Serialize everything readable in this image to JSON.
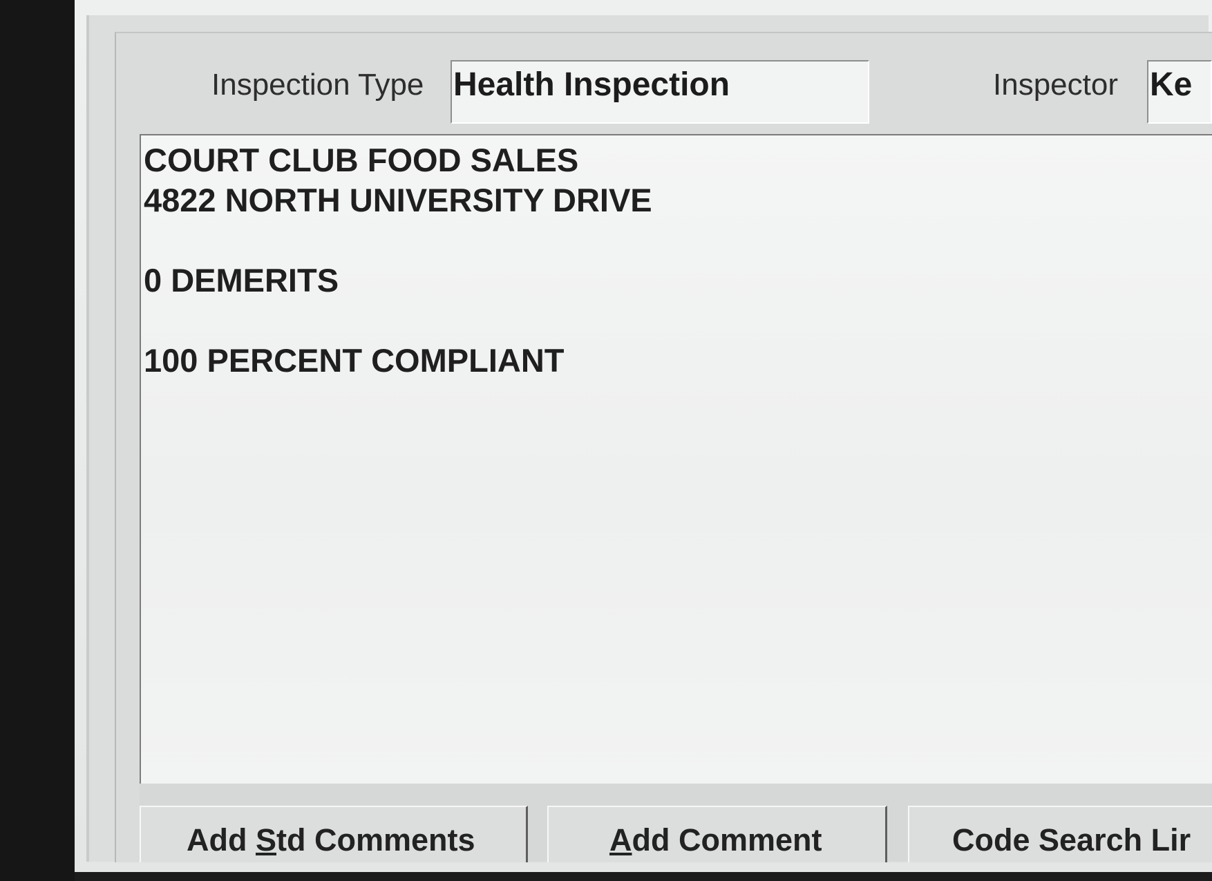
{
  "form": {
    "inspection_type_label": "Inspection Type",
    "inspection_type_value": "Health Inspection",
    "inspector_label": "Inspector",
    "inspector_value": "Ke"
  },
  "comments": {
    "lines": [
      "COURT CLUB FOOD SALES",
      "4822 NORTH UNIVERSITY DRIVE",
      "",
      "0 DEMERITS",
      "",
      "100 PERCENT COMPLIANT"
    ]
  },
  "buttons": {
    "add_std_comments": {
      "prefix": "Add ",
      "mnemonic": "S",
      "suffix": "td Comments"
    },
    "add_comment": {
      "prefix": "",
      "mnemonic": "A",
      "suffix": "dd Comment"
    },
    "code_search": {
      "label": "Code Search Lir"
    }
  },
  "colors": {
    "window_bg": "#dcdedd",
    "field_bg": "#f2f3f3",
    "text": "#1f1f1f"
  }
}
